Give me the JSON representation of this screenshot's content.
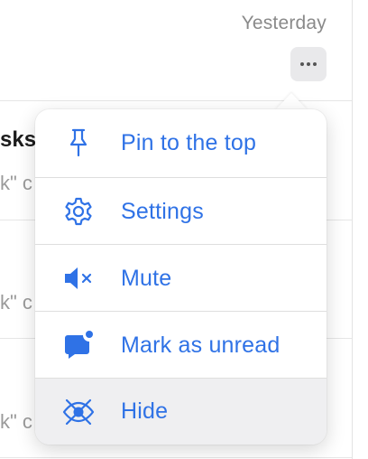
{
  "conversation": {
    "date": "Yesterday",
    "title_fragment": "sks",
    "preview_fragment": "k\" c"
  },
  "more_button": {
    "icon": "ellipsis-icon"
  },
  "context_menu": {
    "accent_color": "#2f72e6",
    "items": [
      {
        "label": "Pin to the top",
        "icon": "pin-icon"
      },
      {
        "label": "Settings",
        "icon": "gear-icon"
      },
      {
        "label": "Mute",
        "icon": "mute-icon"
      },
      {
        "label": "Mark as unread",
        "icon": "unread-message-icon"
      },
      {
        "label": "Hide",
        "icon": "hide-icon",
        "highlighted": true
      }
    ]
  }
}
